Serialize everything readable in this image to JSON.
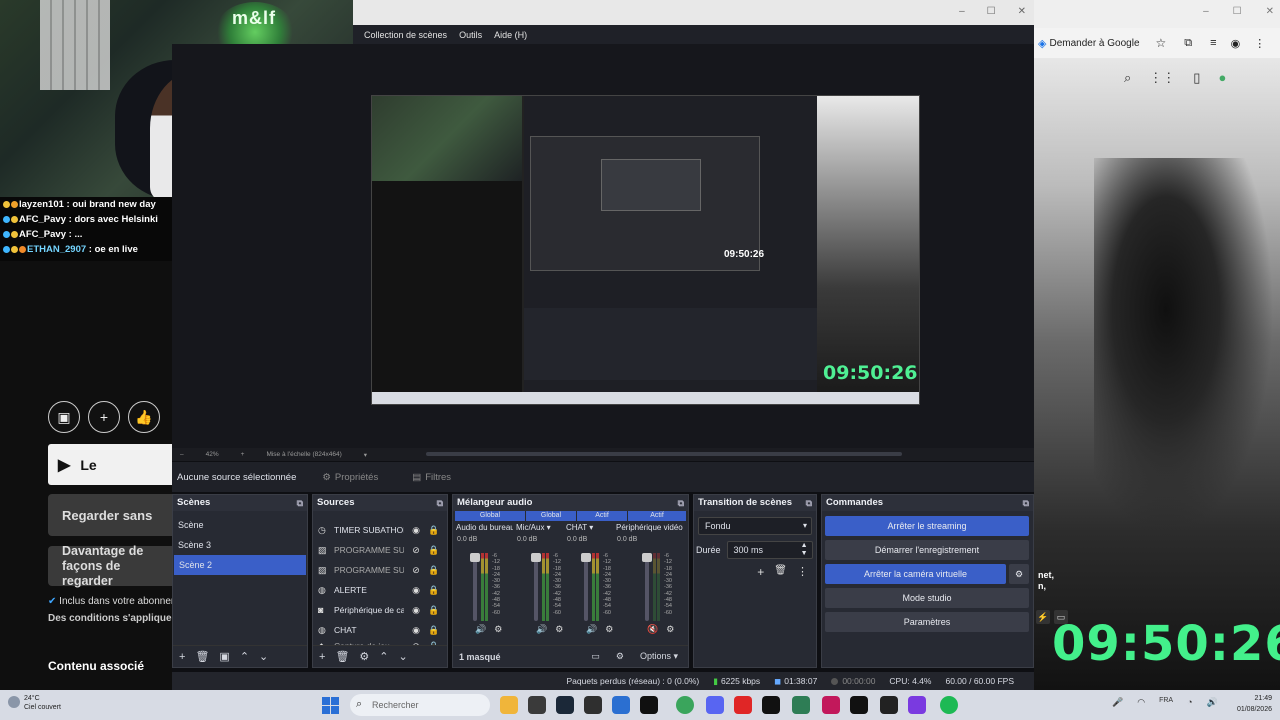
{
  "chat": [
    {
      "user": "layzen101",
      "msg": "oui brand new day",
      "user_color": "#ffffff"
    },
    {
      "user": "AFC_Pavy",
      "msg": "dors avec Helsinki",
      "user_color": "#ffffff"
    },
    {
      "user": "AFC_Pavy",
      "msg": "...",
      "user_color": "#ffffff"
    },
    {
      "user": "ETHAN_2907",
      "msg": "oe en live",
      "user_color": "#4ea6ff"
    }
  ],
  "webcam": {
    "sign": "m&lf"
  },
  "youtube": {
    "watch_btn": "Le",
    "watch_free": "Regarder sans",
    "more_ways": "Davantage de façons de regarder",
    "included": "Inclus dans votre abonnement",
    "conditions": "Des conditions s'appliquent",
    "related": "Contenu associé"
  },
  "browser": {
    "ask_google": "Demander à Google",
    "partial_text": "net,\nn,"
  },
  "clock": "09:50:26",
  "obs": {
    "menu": [
      "Collection de scènes",
      "Outils",
      "Aide (H)"
    ],
    "zoom": "42%",
    "scale_label": "Mise à l'échelle (824x464)",
    "no_source": "Aucune source sélectionnée",
    "properties": "Propriétés",
    "filters": "Filtres",
    "scenes_title": "Scènes",
    "scenes": [
      "Scène",
      "Scène 3",
      "Scène 2"
    ],
    "sources_title": "Sources",
    "sources": [
      {
        "icon": "timer",
        "name": "TIMER SUBATHON"
      },
      {
        "icon": "image",
        "name": "PROGRAMME SUBATHON"
      },
      {
        "icon": "image",
        "name": "PROGRAMME SUBATHON"
      },
      {
        "icon": "alert",
        "name": "ALERTE"
      },
      {
        "icon": "camera",
        "name": "Périphérique de capture vidéo"
      },
      {
        "icon": "chat",
        "name": "CHAT"
      },
      {
        "icon": "capture",
        "name": "Capture de jeu"
      }
    ],
    "mixer_title": "Mélangeur audio",
    "mixer_headers": [
      "Global",
      "Global",
      "Actif",
      "Actif"
    ],
    "channels": [
      {
        "name": "Audio du bureau",
        "db": "0.0 dB"
      },
      {
        "name": "Mic/Aux",
        "db": "0.0 dB"
      },
      {
        "name": "CHAT",
        "db": "0.0 dB"
      },
      {
        "name": "Périphérique vidéo",
        "db": "0.0 dB"
      }
    ],
    "scale": [
      "-6",
      "-12",
      "-18",
      "-24",
      "-30",
      "-36",
      "-42",
      "-48",
      "-54",
      "-60"
    ],
    "hidden": "1 masqué",
    "options": "Options",
    "transition_title": "Transition de scènes",
    "transition": "Fondu",
    "duration_label": "Durée",
    "duration": "300 ms",
    "commands_title": "Commandes",
    "commands": [
      "Arrêter le streaming",
      "Démarrer l'enregistrement",
      "Arrêter la caméra virtuelle",
      "Mode studio",
      "Paramètres"
    ],
    "status": {
      "dropped": "Paquets perdus (réseau) : 0 (0.0%)",
      "kbps": "6225 kbps",
      "stream_time": "01:38:07",
      "rec_time": "00:00:00",
      "cpu": "CPU: 4.4%",
      "fps": "60.00 / 60.00 FPS"
    }
  },
  "taskbar": {
    "temp": "24°C",
    "weather": "Ciel couvert",
    "search": "Rechercher",
    "lang": "FRA",
    "time": "21:49",
    "date": "01/08/2026"
  },
  "colors": {
    "accent": "#3a5fc8",
    "clock_green": "#43f08b"
  }
}
